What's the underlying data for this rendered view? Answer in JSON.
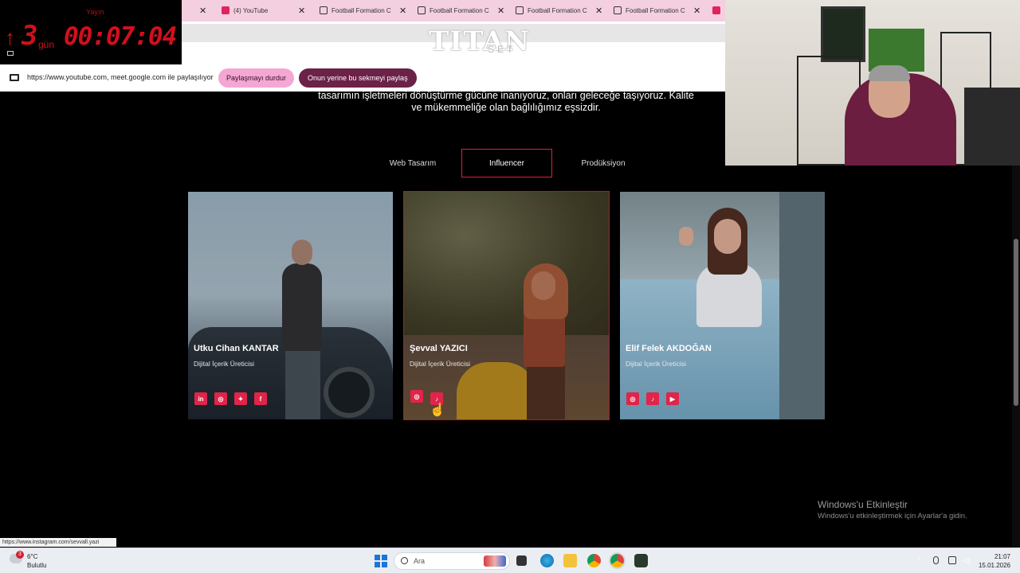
{
  "timer": {
    "label": "Yayın",
    "days": "3",
    "days_unit": "gün",
    "clock": "00:07:04"
  },
  "tabs": [
    {
      "title": "(4) YouTube",
      "icon": "youtube-icon"
    },
    {
      "title": "Football Formation C",
      "icon": "grid-icon"
    },
    {
      "title": "Football Formation C",
      "icon": "grid-icon"
    },
    {
      "title": "Football Formation C",
      "icon": "grid-icon"
    },
    {
      "title": "Football Formation C",
      "icon": "grid-icon"
    }
  ],
  "site": {
    "logo": "TITAN",
    "logo_sub": "SET",
    "intro_line1": "tasarımın işletmeleri dönüştürme gücüne inanıyoruz, onları geleceğe taşıyoruz. Kalite",
    "intro_line2": "ve mükemmeliğe olan bağlılığımız eşsizdir."
  },
  "sharebar": {
    "text": "https://www.youtube.com, meet.google.com ile paylaşılıyor",
    "stop_label": "Paylaşmayı durdur",
    "share_tab_label": "Onun yerine bu sekmeyi paylaş"
  },
  "categories": {
    "web": "Web Tasarım",
    "influencer": "Influencer",
    "production": "Prodüksiyon",
    "active": "Influencer"
  },
  "cards": [
    {
      "name": "Utku Cihan KANTAR",
      "role": "Dijital İçerik Üreticisi",
      "socials": [
        "in",
        "ig",
        "tw",
        "fb"
      ]
    },
    {
      "name": "Şevval YAZICI",
      "role": "Dijital İçerik Üreticisi",
      "socials": [
        "ig",
        "tt"
      ]
    },
    {
      "name": "Elif Felek AKDOĞAN",
      "role": "Dijital İçerik Üreticisi",
      "socials": [
        "ig",
        "tt",
        "yt"
      ]
    }
  ],
  "watermark": {
    "title": "Windows'u Etkinleştir",
    "subtitle": "Windows'u etkinleştirmek için Ayarlar'a gidin."
  },
  "status_url": "https://www.instagram.com/sevvall.yazi",
  "taskbar": {
    "weather_temp": "6°C",
    "weather_desc": "Bulutlu",
    "weather_badge": "3",
    "search_placeholder": "Ara",
    "time": "21:07",
    "date": "15.01.2026"
  },
  "colors": {
    "accent": "#e0244a",
    "active_border": "#e0213c",
    "timer_red": "#d0101c",
    "tab_strip": "#f4cfe0"
  }
}
